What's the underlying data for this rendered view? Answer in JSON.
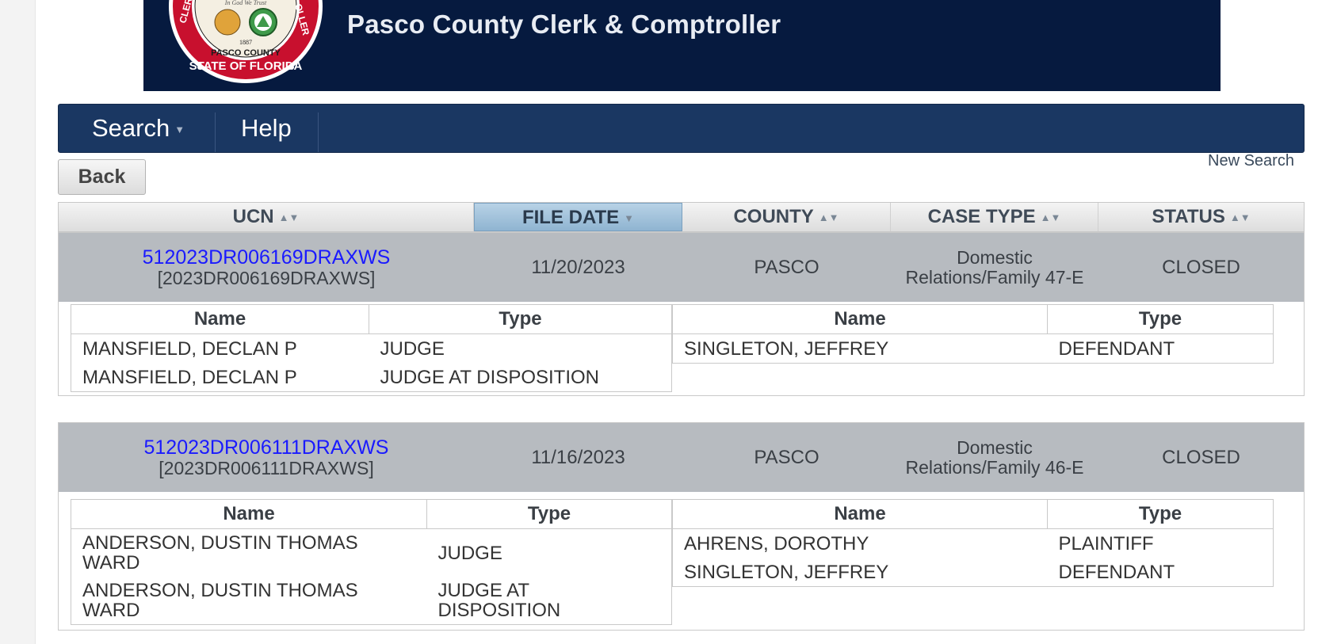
{
  "banner": {
    "title": "Pasco County Clerk & Comptroller",
    "seal": {
      "motto": "In God We Trust",
      "year": "1887",
      "ring_left": "CLERK",
      "ring_right": "OLLER",
      "county": "PASCO COUNTY",
      "state": "STATE OF FLORIDA"
    }
  },
  "nav": {
    "search_label": "Search",
    "help_label": "Help"
  },
  "actions": {
    "back_label": "Back",
    "new_search_label": "New Search"
  },
  "results_header": {
    "ucn": "UCN",
    "file_date": "FILE DATE",
    "county": "COUNTY",
    "case_type": "CASE TYPE",
    "status": "STATUS"
  },
  "cases": [
    {
      "ucn": "512023DR006169DRAXWS",
      "case_number": "[2023DR006169DRAXWS]",
      "file_date": "11/20/2023",
      "county": "PASCO",
      "case_type": "Domestic Relations/Family 47-E",
      "status": "CLOSED",
      "left_parties_header": {
        "name": "Name",
        "type": "Type"
      },
      "left_parties": [
        {
          "name": "MANSFIELD, DECLAN P",
          "type": "JUDGE"
        },
        {
          "name": "MANSFIELD, DECLAN P",
          "type": "JUDGE AT DISPOSITION"
        }
      ],
      "right_parties_header": {
        "name": "Name",
        "type": "Type"
      },
      "right_parties": [
        {
          "name": "SINGLETON, JEFFREY",
          "type": "DEFENDANT"
        }
      ]
    },
    {
      "ucn": "512023DR006111DRAXWS",
      "case_number": "[2023DR006111DRAXWS]",
      "file_date": "11/16/2023",
      "county": "PASCO",
      "case_type": "Domestic Relations/Family 46-E",
      "status": "CLOSED",
      "left_parties_header": {
        "name": "Name",
        "type": "Type"
      },
      "left_parties": [
        {
          "name": "ANDERSON, DUSTIN THOMAS WARD",
          "type": "JUDGE"
        },
        {
          "name": "ANDERSON, DUSTIN THOMAS WARD",
          "type": "JUDGE AT DISPOSITION"
        }
      ],
      "right_parties_header": {
        "name": "Name",
        "type": "Type"
      },
      "right_parties": [
        {
          "name": "AHRENS, DOROTHY",
          "type": "PLAINTIFF"
        },
        {
          "name": "SINGLETON, JEFFREY",
          "type": "DEFENDANT"
        }
      ]
    }
  ],
  "icons": {
    "sort": "sort-icon",
    "sort_desc": "sort-desc-icon",
    "dropdown": "caret-down-icon",
    "seal": "county-seal-icon"
  },
  "colors": {
    "banner_bg": "#061a3f",
    "nav_bg": "#1a3762",
    "case_row_bg": "#b7bbc0",
    "active_header_bg": "#a6c4dc",
    "link": "#1a1aff"
  }
}
